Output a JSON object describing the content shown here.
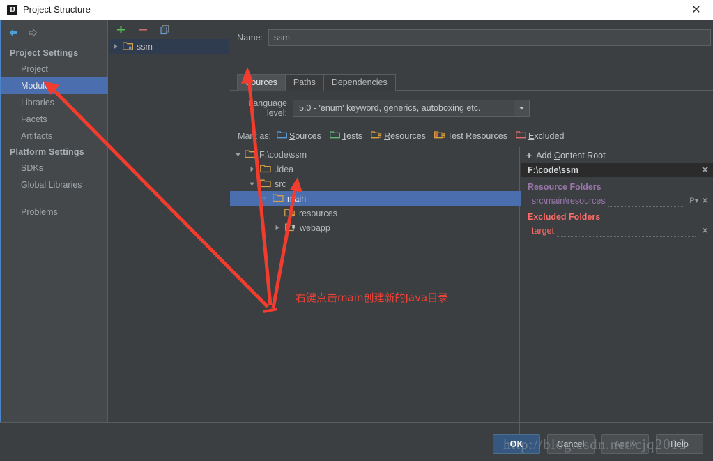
{
  "window": {
    "title": "Project Structure",
    "app_icon": "intellij-idea-icon",
    "close_label": "✕"
  },
  "nav": {
    "back_icon": "arrow-left-icon",
    "forward_icon": "arrow-right-icon",
    "groups": [
      {
        "header": "Project Settings",
        "items": [
          {
            "label": "Project",
            "selected": false
          },
          {
            "label": "Modules",
            "selected": true
          },
          {
            "label": "Libraries",
            "selected": false
          },
          {
            "label": "Facets",
            "selected": false
          },
          {
            "label": "Artifacts",
            "selected": false
          }
        ]
      },
      {
        "header": "Platform Settings",
        "items": [
          {
            "label": "SDKs",
            "selected": false
          },
          {
            "label": "Global Libraries",
            "selected": false
          }
        ]
      }
    ],
    "problems_label": "Problems"
  },
  "modules_panel": {
    "toolbar": {
      "add_label": "+",
      "add_icon": "plus-icon",
      "remove_label": "−",
      "remove_icon": "minus-icon",
      "copy_icon": "copy-icon"
    },
    "items": [
      {
        "label": "ssm",
        "icon": "module-folder-icon",
        "expanded": false,
        "selected": true
      }
    ]
  },
  "detail": {
    "name_label": "Name:",
    "name_value": "ssm",
    "name_placeholder": "",
    "tabs": [
      {
        "label": "Sources",
        "active": true
      },
      {
        "label": "Paths",
        "active": false
      },
      {
        "label": "Dependencies",
        "active": false
      }
    ],
    "language_level": {
      "label": "Language level:",
      "value": "5.0 - 'enum' keyword, generics, autoboxing etc.",
      "arrow_icon": "chevron-down-icon"
    },
    "mark_as": {
      "label": "Mark as:",
      "options": [
        {
          "label": "Sources",
          "mnemonic": "S",
          "icon": "folder-sources-icon",
          "color": "#5b9bd5"
        },
        {
          "label": "Tests",
          "mnemonic": "T",
          "icon": "folder-tests-icon",
          "color": "#62b572"
        },
        {
          "label": "Resources",
          "mnemonic": "R",
          "icon": "folder-resources-icon",
          "color": "#d9a13b"
        },
        {
          "label": "Test Resources",
          "mnemonic": "",
          "icon": "folder-test-resources-icon",
          "color": "#d9a13b"
        },
        {
          "label": "Excluded",
          "mnemonic": "E",
          "icon": "folder-excluded-icon",
          "color": "#e56c6c"
        }
      ]
    }
  },
  "tree": [
    {
      "label": "F:\\code\\ssm",
      "indent": 0,
      "toggle": "expanded",
      "icon": "folder-icon",
      "selected": false
    },
    {
      "label": ".idea",
      "indent": 1,
      "toggle": "collapsed",
      "icon": "folder-icon",
      "selected": false
    },
    {
      "label": "src",
      "indent": 1,
      "toggle": "expanded",
      "icon": "folder-icon",
      "selected": false
    },
    {
      "label": "main",
      "indent": 2,
      "toggle": "expanded",
      "icon": "folder-icon",
      "selected": true
    },
    {
      "label": "resources",
      "indent": 3,
      "toggle": "none",
      "icon": "folder-resources-icon",
      "selected": false
    },
    {
      "label": "webapp",
      "indent": 3,
      "toggle": "collapsed",
      "icon": "folder-webapp-icon",
      "selected": false
    }
  ],
  "roots": {
    "add_content_root": "Add Content Root",
    "add_icon": "plus-icon",
    "content_root": {
      "path": "F:\\code\\ssm",
      "remove_icon": "close-icon",
      "remove_label": "✕"
    },
    "sections": [
      {
        "title": "Resource Folders",
        "kind": "res",
        "color": "#9876aa",
        "rows": [
          {
            "path": "src\\main\\resources",
            "properties_label": "P",
            "properties_icon": "properties-dropdown-icon",
            "remove_icon": "close-icon",
            "remove_label": "✕"
          }
        ]
      },
      {
        "title": "Excluded Folders",
        "kind": "exc",
        "color": "#ff6b68",
        "rows": [
          {
            "path": "target",
            "properties_label": "",
            "properties_icon": "",
            "remove_icon": "close-icon",
            "remove_label": "✕"
          }
        ]
      }
    ]
  },
  "buttons": [
    {
      "label": "OK",
      "style": "primary"
    },
    {
      "label": "Cancel",
      "style": "normal"
    },
    {
      "label": "Apply",
      "style": "disabled"
    },
    {
      "label": "Help",
      "style": "normal"
    }
  ],
  "annotations": {
    "note_text": "右键点击main创建新的Java目录",
    "note_color": "#ef4136",
    "arrow_color": "#f23c2e"
  },
  "watermark": {
    "text": "http://blog.csdn.net/cjq2013"
  },
  "colors": {
    "background": "#3c3f41",
    "nav_background": "#45484a",
    "selection_blue": "#4b6eaf",
    "module_selection": "#2f3c4f",
    "resource_purple": "#9876aa",
    "excluded_red": "#ff6b68",
    "accent_line": "#4d84c7"
  }
}
